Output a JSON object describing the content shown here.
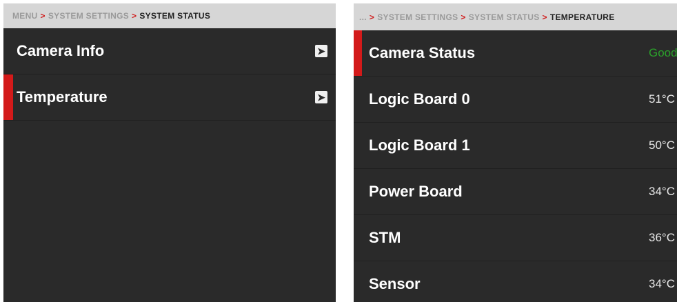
{
  "left_panel": {
    "breadcrumb": {
      "items": [
        "MENU",
        "SYSTEM SETTINGS"
      ],
      "separator": ">",
      "current": "SYSTEM STATUS"
    },
    "rows": [
      {
        "label": "Camera Info",
        "selected": false,
        "icon": "chevron-right-icon"
      },
      {
        "label": "Temperature",
        "selected": true,
        "icon": "chevron-right-icon"
      }
    ]
  },
  "right_panel": {
    "breadcrumb": {
      "items": [
        "...",
        "SYSTEM SETTINGS",
        "SYSTEM STATUS"
      ],
      "separator": ">",
      "current": "TEMPERATURE"
    },
    "rows": [
      {
        "label": "Camera Status",
        "value": "Good",
        "selected": true
      },
      {
        "label": "Logic Board 0",
        "value": "51°C",
        "selected": false
      },
      {
        "label": "Logic Board 1",
        "value": "50°C",
        "selected": false
      },
      {
        "label": "Power Board",
        "value": "34°C",
        "selected": false
      },
      {
        "label": "STM",
        "value": "36°C",
        "selected": false
      },
      {
        "label": "Sensor",
        "value": "34°C",
        "selected": false
      }
    ]
  },
  "colors": {
    "panel_bg": "#2a2a2a",
    "breadcrumb_bg": "#d6d6d6",
    "accent_red": "#d31a1a",
    "status_good": "#2aa12a"
  }
}
